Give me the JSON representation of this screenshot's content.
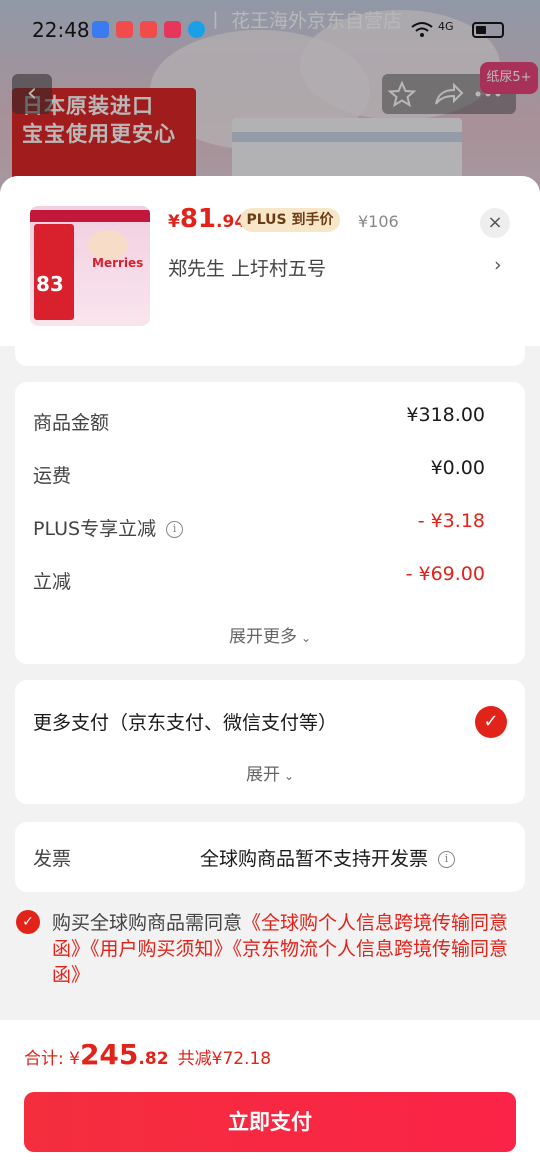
{
  "status_bar": {
    "time": "22:48",
    "network": "4G"
  },
  "background_page": {
    "store_title": "丨 花王海外京东自营店",
    "banner_line1": "日本原装进口",
    "banner_line2": "宝宝使用更安心",
    "paper_tag": "纸尿5+"
  },
  "product": {
    "thumbnail": {
      "brand": "Merries",
      "price_badge": "83"
    },
    "price": {
      "yen": "¥",
      "integer": "81",
      "decimal": ".94"
    },
    "plus_badge": "PLUS 到手价",
    "original_price": "¥106",
    "address": "郑先生  上圩村五号",
    "address_arrow": "›",
    "close": "×"
  },
  "fees": {
    "rows": [
      {
        "label": "商品金额",
        "value": "¥318.00",
        "emphasis": "normal",
        "info": false
      },
      {
        "label": "运费",
        "value": "¥0.00",
        "emphasis": "normal",
        "info": false
      },
      {
        "label": "PLUS专享立减",
        "value": "- ¥3.18",
        "emphasis": "red",
        "info": true
      },
      {
        "label": "立减",
        "value": "- ¥69.00",
        "emphasis": "red",
        "info": false
      }
    ],
    "expand_more": "展开更多"
  },
  "payment": {
    "label": "更多支付（京东支付、微信支付等）",
    "selected": true,
    "expand": "展开"
  },
  "invoice": {
    "label": "发票",
    "value": "全球购商品暂不支持开发票"
  },
  "agreement": {
    "prefix": "购买全球购商品需同意",
    "links": [
      "《全球购个人信息跨境传输同意函》",
      "《用户购买须知》",
      "《京东物流个人信息跨境传输同意函》"
    ]
  },
  "summary": {
    "total_label": "合计: ¥",
    "total_integer": "245",
    "total_decimal": ".82",
    "saved": "共减¥72.18"
  },
  "pay_button": "立即支付",
  "colors": {
    "accent_red": "#e2231a",
    "plus_badge_bg": "#f7e7c8",
    "plus_badge_text": "#6b3b14"
  }
}
